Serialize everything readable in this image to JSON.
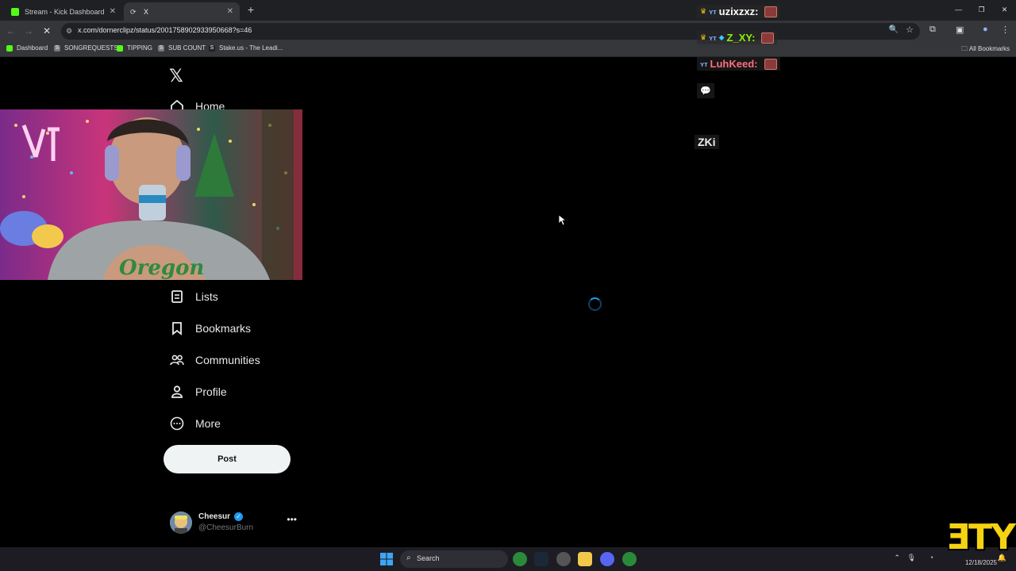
{
  "browser": {
    "tabs": [
      {
        "title": "Stream - Kick Dashboard",
        "fav_color": "#53fc18"
      },
      {
        "title": "X",
        "fav_color": "#888888"
      }
    ],
    "new_tab": "+",
    "url": "x.com/dornerclipz/status/2001758902933950668?s=46",
    "bookmarks": [
      {
        "label": "Dashboard",
        "color": "#53fc18"
      },
      {
        "label": "SONGREQUESTS",
        "color": "#3a3a3a"
      },
      {
        "label": "TIPPING",
        "color": "#53fc18"
      },
      {
        "label": "SUB COUNT",
        "color": "#3a3a3a"
      },
      {
        "label": "Stake.us - The Leadi...",
        "color": "#3a3a3a"
      }
    ],
    "all_bookmarks": "All Bookmarks"
  },
  "x_page": {
    "nav": {
      "home": "Home",
      "lists": "Lists",
      "bookmarks": "Bookmarks",
      "communities": "Communities",
      "profile": "Profile",
      "more": "More"
    },
    "post_label": "Post",
    "account": {
      "name": "Cheesur",
      "handle": "@CheesurBurn"
    }
  },
  "chat": [
    {
      "user": "uzixzxz:",
      "color": "#ffffff"
    },
    {
      "user": "Z_XY:",
      "color": "#8bf10a"
    },
    {
      "user": "LuhKeed:",
      "color": "#ff6f7d"
    }
  ],
  "chat_fragment": "ZKi",
  "taskbar": {
    "search_label": "Search",
    "date": "12/18/2025"
  },
  "brand_mark": "ƎTY",
  "colors": {
    "accent": "#1d9bf0",
    "kick_green": "#53fc18"
  }
}
